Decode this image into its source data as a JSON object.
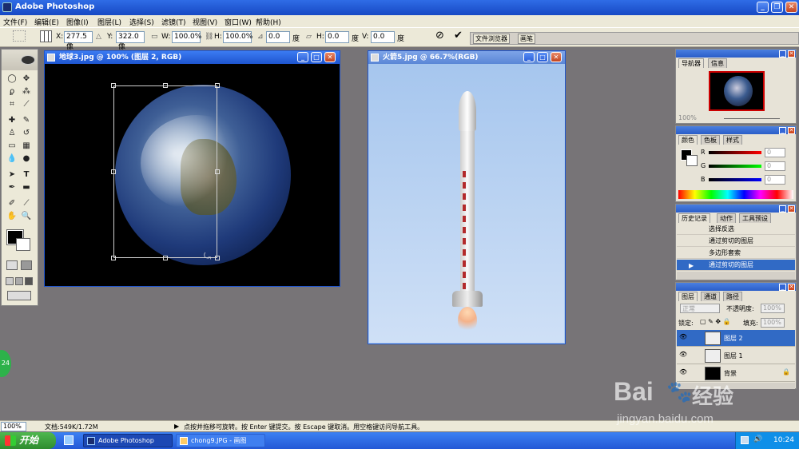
{
  "app": {
    "title": "Adobe Photoshop"
  },
  "menu": [
    "文件(F)",
    "编辑(E)",
    "图像(I)",
    "图层(L)",
    "选择(S)",
    "滤镜(T)",
    "视图(V)",
    "窗口(W)",
    "帮助(H)"
  ],
  "options": {
    "x_label": "X:",
    "x": "277.5 像",
    "y_label": "Y:",
    "y": "322.0 像",
    "w_label": "W:",
    "w": "100.0%",
    "h_label": "H:",
    "h": "100.0%",
    "angle": "0.0",
    "angle_unit": "度",
    "hskew_label": "H:",
    "hskew": "0.0",
    "vskew_label": "V:",
    "vskew": "0.0",
    "file_browser": "文件浏览器",
    "brushes": "画笔"
  },
  "doc1": {
    "title": "地球3.jpg @ 100% (图层 2, RGB)"
  },
  "doc2": {
    "title": "火箭5.jpg @ 66.7%(RGB)"
  },
  "navigator": {
    "tabs": [
      "导航器",
      "信息"
    ],
    "zoom": "100%"
  },
  "color": {
    "tabs": [
      "颜色",
      "色板",
      "样式"
    ],
    "r_label": "R",
    "g_label": "G",
    "b_label": "B",
    "r": "0",
    "g": "0",
    "b": "0"
  },
  "history": {
    "tabs": [
      "历史记录",
      "动作",
      "工具预设"
    ],
    "items": [
      "选择反选",
      "通过剪切的图层",
      "多边形套索",
      "通过剪切的图层"
    ]
  },
  "layers": {
    "tabs": [
      "图层",
      "通道",
      "路径"
    ],
    "blend": "正常",
    "opacity_label": "不透明度:",
    "opacity": "100%",
    "lock_label": "锁定:",
    "fill_label": "填充:",
    "fill": "100%",
    "items": [
      "图层 2",
      "图层 1",
      "背景"
    ]
  },
  "status": {
    "zoom": "100%",
    "doc": "文档:549K/1.72M",
    "hint": "点按并拖移可旋转。按 Enter 键提交。按 Escape 键取消。用空格键访问导航工具。"
  },
  "taskbar": {
    "start": "开始",
    "tasks": [
      "Adobe Photoshop",
      "chong9.JPG - 画图"
    ],
    "clock": "10:24"
  },
  "watermark": {
    "brand": "Bai",
    "brand2": "经验",
    "url": "jingyan.baidu.com"
  },
  "badge": "24"
}
